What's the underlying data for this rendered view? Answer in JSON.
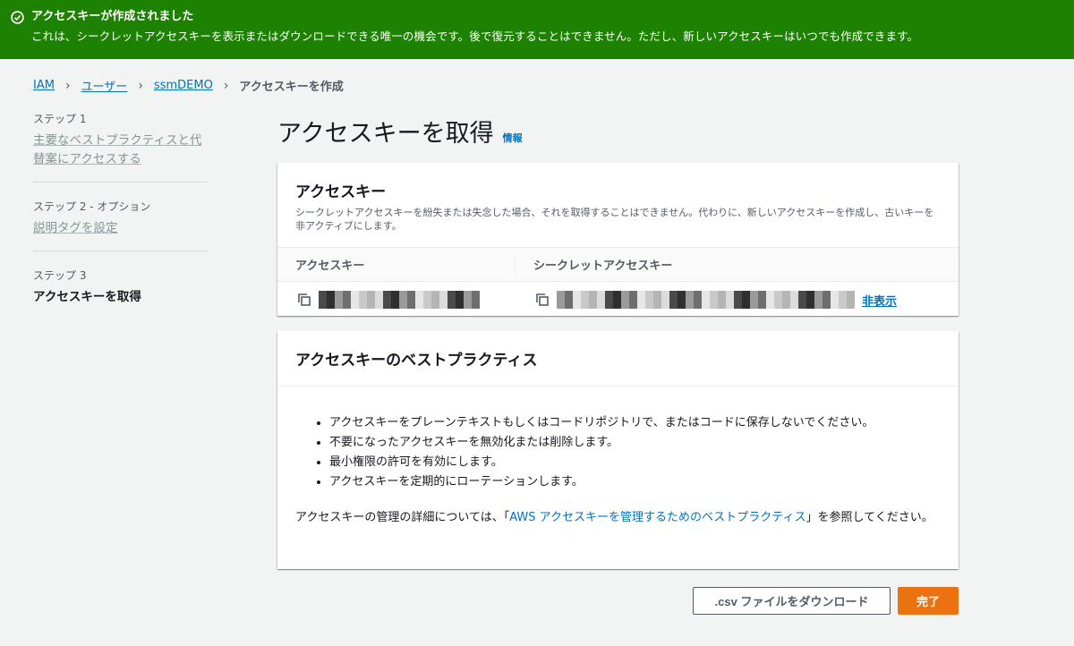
{
  "flash": {
    "title": "アクセスキーが作成されました",
    "message": "これは、シークレットアクセスキーを表示またはダウンロードできる唯一の機会です。後で復元することはできません。ただし、新しいアクセスキーはいつでも作成できます。",
    "icon": "check-circle-icon",
    "color": "#1d8102"
  },
  "breadcrumb": {
    "items": [
      "IAM",
      "ユーザー",
      "ssmDEMO"
    ],
    "current": "アクセスキーを作成"
  },
  "wizard": {
    "steps": [
      {
        "label": "ステップ 1",
        "title": "主要なベストプラクティスと代替案にアクセスする"
      },
      {
        "label": "ステップ 2 - オプション",
        "title": "説明タグを設定"
      },
      {
        "label": "ステップ 3",
        "title": "アクセスキーを取得"
      }
    ]
  },
  "page": {
    "title": "アクセスキーを取得",
    "info": "情報"
  },
  "keys_panel": {
    "title": "アクセスキー",
    "description": "シークレットアクセスキーを紛失または失念した場合、それを取得することはできません。代わりに、新しいアクセスキーを作成し、古いキーを非アクティブにします。",
    "columns": [
      "アクセスキー",
      "シークレットアクセスキー"
    ],
    "hide_label": "非表示"
  },
  "best_panel": {
    "title": "アクセスキーのベストプラクティス",
    "items": [
      "アクセスキーをプレーンテキストもしくはコードリポジトリで、またはコードに保存しないでください。",
      "不要になったアクセスキーを無効化または削除します。",
      "最小権限の許可を有効にします。",
      "アクセスキーを定期的にローテーションします。"
    ],
    "note_before": "アクセスキーの管理の詳細については、「",
    "note_link": "AWS アクセスキーを管理するためのベストプラクティス",
    "note_after": "」を参照してください。"
  },
  "actions": {
    "download": ".csv ファイルをダウンロード",
    "done": "完了",
    "primary_color": "#ec7211"
  }
}
